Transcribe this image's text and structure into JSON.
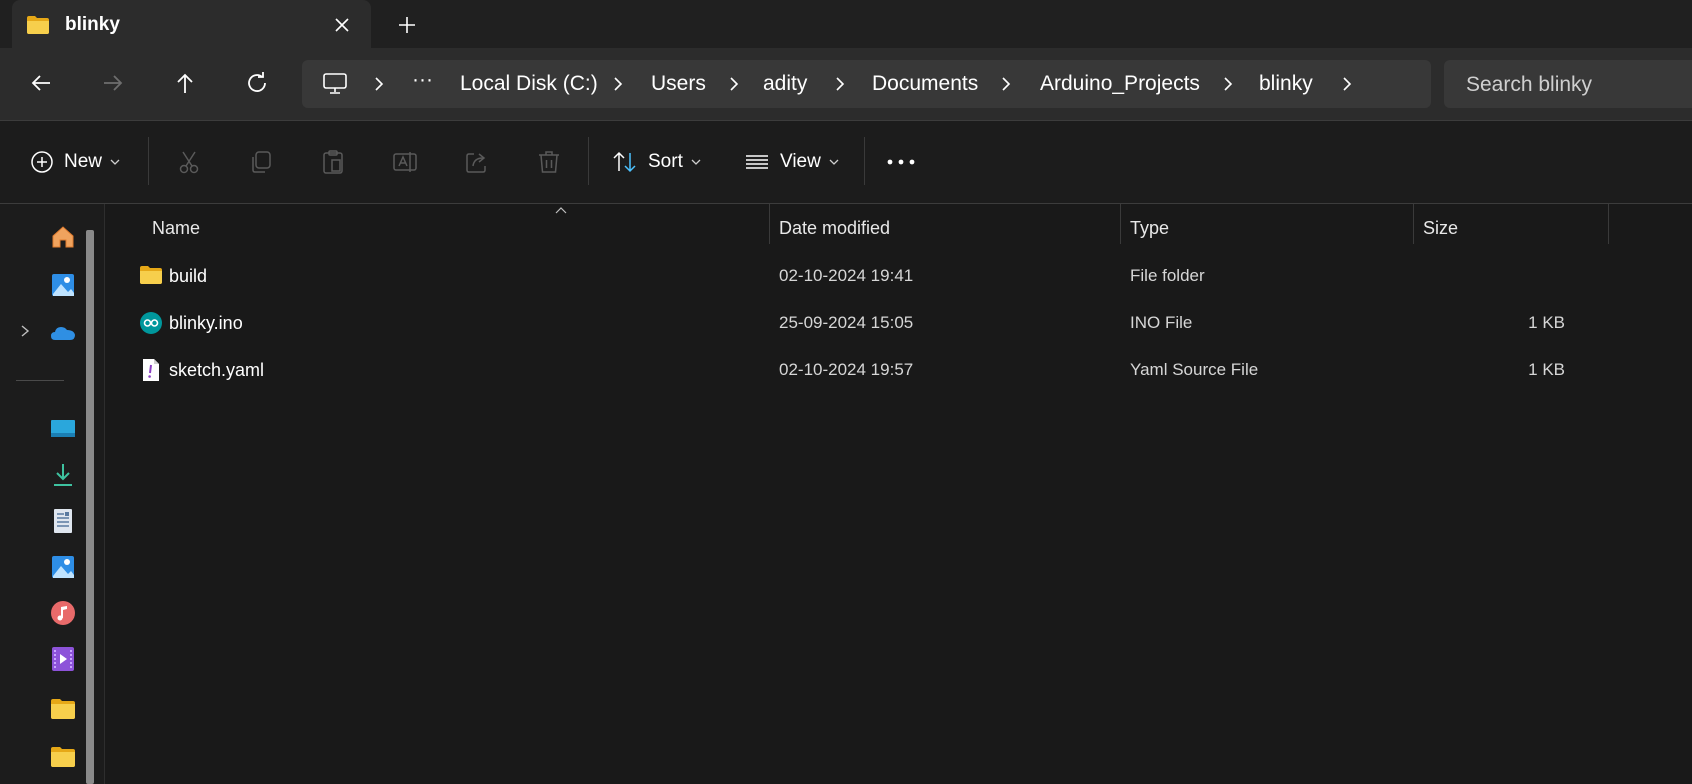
{
  "tab": {
    "title": "blinky",
    "close_icon": "close-icon",
    "new_tab_icon": "plus-icon"
  },
  "nav": {
    "back": "arrow-left-icon",
    "forward": "arrow-right-icon",
    "up": "arrow-up-icon",
    "refresh": "refresh-icon"
  },
  "breadcrumb": {
    "overflow": "···",
    "segments": [
      "Local Disk (C:)",
      "Users",
      "adity",
      "Documents",
      "Arduino_Projects",
      "blinky"
    ]
  },
  "search": {
    "placeholder": "Search blinky"
  },
  "toolbar": {
    "new_label": "New",
    "sort_label": "Sort",
    "view_label": "View"
  },
  "columns": {
    "name": "Name",
    "date": "Date modified",
    "type": "Type",
    "size": "Size"
  },
  "files": [
    {
      "name": "build",
      "date": "02-10-2024 19:41",
      "type": "File folder",
      "size": "",
      "icon": "folder-icon"
    },
    {
      "name": "blinky.ino",
      "date": "25-09-2024 15:05",
      "type": "INO File",
      "size": "1 KB",
      "icon": "arduino-icon"
    },
    {
      "name": "sketch.yaml",
      "date": "02-10-2024 19:57",
      "type": "Yaml Source File",
      "size": "1 KB",
      "icon": "yaml-file-icon"
    }
  ],
  "colors": {
    "folder": "#f3c948",
    "accent": "#4cc2ff",
    "arduino": "#00979c"
  }
}
